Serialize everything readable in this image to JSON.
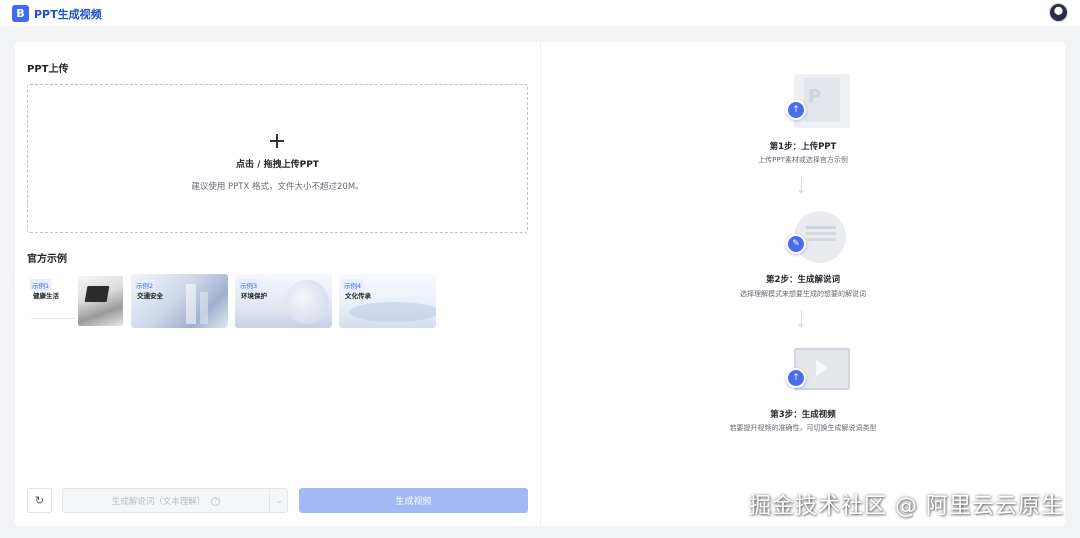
{
  "app": {
    "logo_letter": "B",
    "title": "PPT生成视频",
    "accent_color": "#3d6cf5"
  },
  "upload": {
    "section_title": "PPT上传",
    "main_text": "点击 / 拖拽上传PPT",
    "hint_text": "建议使用 PPTX 格式，文件大小不超过20M。"
  },
  "examples": {
    "section_title": "官方示例",
    "items": [
      {
        "tag": "示例1",
        "name": "健康生活"
      },
      {
        "tag": "示例2",
        "name": "交通安全"
      },
      {
        "tag": "示例3",
        "name": "环境保护"
      },
      {
        "tag": "示例4",
        "name": "文化传承"
      }
    ]
  },
  "controls": {
    "refresh_icon": "↻",
    "mode_select_value": "生成解说词（文本理解）",
    "help_icon": "?",
    "chevron_icon": "⌄",
    "generate_label": "生成视频",
    "generate_button_color": "#a3b8f5"
  },
  "steps": [
    {
      "title": "第1步：上传PPT",
      "desc": "上传PPT素材或选择官方示例",
      "badge_icon": "upload-icon",
      "art_glyph": "P"
    },
    {
      "title": "第2步：生成解说词",
      "desc": "选择理解模式来想要生成的想要的解说词",
      "badge_icon": "pen-icon"
    },
    {
      "title": "第3步：生成视频",
      "desc": "若要提升视频的准确性，可切换生成解说词类型",
      "badge_icon": "upload-icon"
    }
  ],
  "watermark": "掘金技术社区 @ 阿里云云原生"
}
